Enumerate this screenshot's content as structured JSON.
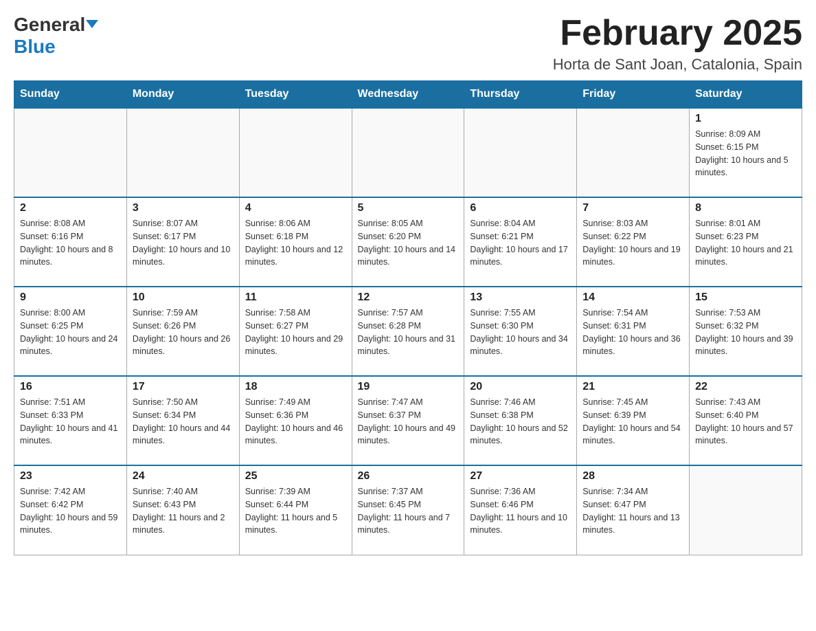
{
  "header": {
    "logo_general": "General",
    "logo_blue": "Blue",
    "title": "February 2025",
    "subtitle": "Horta de Sant Joan, Catalonia, Spain"
  },
  "weekdays": [
    "Sunday",
    "Monday",
    "Tuesday",
    "Wednesday",
    "Thursday",
    "Friday",
    "Saturday"
  ],
  "weeks": [
    [
      {
        "day": "",
        "info": ""
      },
      {
        "day": "",
        "info": ""
      },
      {
        "day": "",
        "info": ""
      },
      {
        "day": "",
        "info": ""
      },
      {
        "day": "",
        "info": ""
      },
      {
        "day": "",
        "info": ""
      },
      {
        "day": "1",
        "info": "Sunrise: 8:09 AM\nSunset: 6:15 PM\nDaylight: 10 hours and 5 minutes."
      }
    ],
    [
      {
        "day": "2",
        "info": "Sunrise: 8:08 AM\nSunset: 6:16 PM\nDaylight: 10 hours and 8 minutes."
      },
      {
        "day": "3",
        "info": "Sunrise: 8:07 AM\nSunset: 6:17 PM\nDaylight: 10 hours and 10 minutes."
      },
      {
        "day": "4",
        "info": "Sunrise: 8:06 AM\nSunset: 6:18 PM\nDaylight: 10 hours and 12 minutes."
      },
      {
        "day": "5",
        "info": "Sunrise: 8:05 AM\nSunset: 6:20 PM\nDaylight: 10 hours and 14 minutes."
      },
      {
        "day": "6",
        "info": "Sunrise: 8:04 AM\nSunset: 6:21 PM\nDaylight: 10 hours and 17 minutes."
      },
      {
        "day": "7",
        "info": "Sunrise: 8:03 AM\nSunset: 6:22 PM\nDaylight: 10 hours and 19 minutes."
      },
      {
        "day": "8",
        "info": "Sunrise: 8:01 AM\nSunset: 6:23 PM\nDaylight: 10 hours and 21 minutes."
      }
    ],
    [
      {
        "day": "9",
        "info": "Sunrise: 8:00 AM\nSunset: 6:25 PM\nDaylight: 10 hours and 24 minutes."
      },
      {
        "day": "10",
        "info": "Sunrise: 7:59 AM\nSunset: 6:26 PM\nDaylight: 10 hours and 26 minutes."
      },
      {
        "day": "11",
        "info": "Sunrise: 7:58 AM\nSunset: 6:27 PM\nDaylight: 10 hours and 29 minutes."
      },
      {
        "day": "12",
        "info": "Sunrise: 7:57 AM\nSunset: 6:28 PM\nDaylight: 10 hours and 31 minutes."
      },
      {
        "day": "13",
        "info": "Sunrise: 7:55 AM\nSunset: 6:30 PM\nDaylight: 10 hours and 34 minutes."
      },
      {
        "day": "14",
        "info": "Sunrise: 7:54 AM\nSunset: 6:31 PM\nDaylight: 10 hours and 36 minutes."
      },
      {
        "day": "15",
        "info": "Sunrise: 7:53 AM\nSunset: 6:32 PM\nDaylight: 10 hours and 39 minutes."
      }
    ],
    [
      {
        "day": "16",
        "info": "Sunrise: 7:51 AM\nSunset: 6:33 PM\nDaylight: 10 hours and 41 minutes."
      },
      {
        "day": "17",
        "info": "Sunrise: 7:50 AM\nSunset: 6:34 PM\nDaylight: 10 hours and 44 minutes."
      },
      {
        "day": "18",
        "info": "Sunrise: 7:49 AM\nSunset: 6:36 PM\nDaylight: 10 hours and 46 minutes."
      },
      {
        "day": "19",
        "info": "Sunrise: 7:47 AM\nSunset: 6:37 PM\nDaylight: 10 hours and 49 minutes."
      },
      {
        "day": "20",
        "info": "Sunrise: 7:46 AM\nSunset: 6:38 PM\nDaylight: 10 hours and 52 minutes."
      },
      {
        "day": "21",
        "info": "Sunrise: 7:45 AM\nSunset: 6:39 PM\nDaylight: 10 hours and 54 minutes."
      },
      {
        "day": "22",
        "info": "Sunrise: 7:43 AM\nSunset: 6:40 PM\nDaylight: 10 hours and 57 minutes."
      }
    ],
    [
      {
        "day": "23",
        "info": "Sunrise: 7:42 AM\nSunset: 6:42 PM\nDaylight: 10 hours and 59 minutes."
      },
      {
        "day": "24",
        "info": "Sunrise: 7:40 AM\nSunset: 6:43 PM\nDaylight: 11 hours and 2 minutes."
      },
      {
        "day": "25",
        "info": "Sunrise: 7:39 AM\nSunset: 6:44 PM\nDaylight: 11 hours and 5 minutes."
      },
      {
        "day": "26",
        "info": "Sunrise: 7:37 AM\nSunset: 6:45 PM\nDaylight: 11 hours and 7 minutes."
      },
      {
        "day": "27",
        "info": "Sunrise: 7:36 AM\nSunset: 6:46 PM\nDaylight: 11 hours and 10 minutes."
      },
      {
        "day": "28",
        "info": "Sunrise: 7:34 AM\nSunset: 6:47 PM\nDaylight: 11 hours and 13 minutes."
      },
      {
        "day": "",
        "info": ""
      }
    ]
  ]
}
